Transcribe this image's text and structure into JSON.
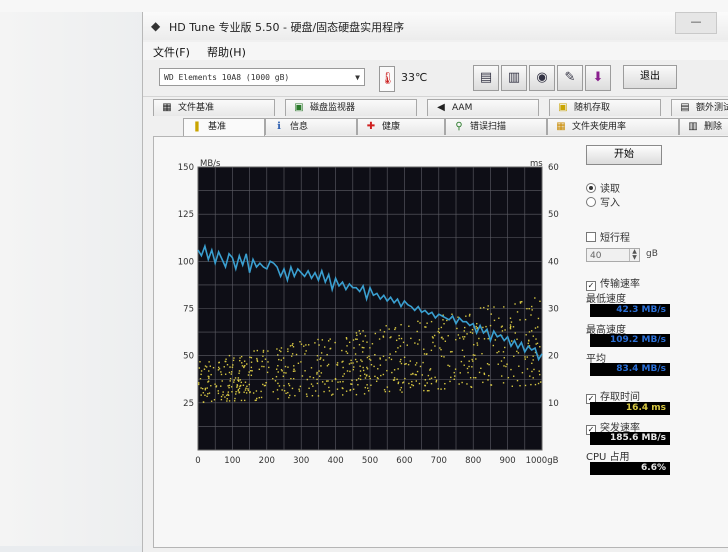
{
  "window": {
    "title": "HD Tune 专业版 5.50 - 硬盘/固态硬盘实用程序",
    "min_btn": "—",
    "menu": [
      "文件(F)",
      "帮助(H)"
    ]
  },
  "toolbar": {
    "drive": "WD    Elements 10A8 (1000 gB)",
    "temperature": "33℃",
    "exit_label": "退出"
  },
  "tabs_top": [
    "文件基准",
    "磁盘监视器",
    "AAM",
    "随机存取",
    "额外测试"
  ],
  "tabs_bottom": [
    "基准",
    "信息",
    "健康",
    "错误扫描",
    "文件夹使用率",
    "删除"
  ],
  "side": {
    "start_label": "开始",
    "read_label": "读取",
    "write_label": "写入",
    "short_stroke_label": "短行程",
    "short_stroke_value": "40",
    "gb_unit": "gB",
    "transfer_rate_label": "传输速率",
    "min_label": "最低速度",
    "min_value": "42.3 MB/s",
    "max_label": "最高速度",
    "max_value": "109.2 MB/s",
    "avg_label": "平均",
    "avg_value": "83.4 MB/s",
    "access_time_label": "存取时间",
    "access_time_value": "16.4 ms",
    "burst_label": "突发速率",
    "burst_value": "185.6 MB/s",
    "cpu_label": "CPU 占用",
    "cpu_value": "6.6%"
  },
  "chart_data": {
    "type": "line",
    "y_left_label": "MB/s",
    "y_right_label": "ms",
    "x_unit": "gB",
    "ylim_left": [
      0,
      150
    ],
    "ylim_right": [
      0,
      60
    ],
    "xlim": [
      0,
      1000
    ],
    "x_ticks": [
      "0",
      "100",
      "200",
      "300",
      "400",
      "500",
      "600",
      "700",
      "800",
      "900",
      "1000gB"
    ],
    "y_left_ticks": [
      "150",
      "125",
      "100",
      "75",
      "50",
      "25"
    ],
    "y_right_ticks": [
      "60",
      "50",
      "40",
      "30",
      "20",
      "10"
    ],
    "grid": true,
    "series": [
      {
        "name": "传输速率",
        "axis": "left",
        "color": "#3a9fd0",
        "x": [
          0,
          10,
          20,
          30,
          40,
          50,
          60,
          70,
          80,
          90,
          100,
          110,
          120,
          130,
          140,
          150,
          160,
          170,
          180,
          190,
          200,
          210,
          220,
          230,
          240,
          250,
          260,
          270,
          280,
          290,
          300,
          310,
          320,
          330,
          340,
          350,
          360,
          370,
          380,
          390,
          400,
          410,
          420,
          430,
          440,
          450,
          460,
          470,
          480,
          490,
          500,
          510,
          520,
          530,
          540,
          550,
          560,
          570,
          580,
          590,
          600,
          610,
          620,
          630,
          640,
          650,
          660,
          670,
          680,
          690,
          700,
          710,
          720,
          730,
          740,
          750,
          760,
          770,
          780,
          790,
          800,
          810,
          820,
          830,
          840,
          850,
          860,
          870,
          880,
          890,
          900,
          910,
          920,
          930,
          940,
          950,
          960,
          970,
          980,
          990,
          1000
        ],
        "y": [
          106,
          103,
          108,
          101,
          106,
          99,
          105,
          101,
          97,
          104,
          102,
          96,
          103,
          98,
          104,
          94,
          101,
          97,
          99,
          97,
          96,
          100,
          99,
          97,
          92,
          96,
          90,
          97,
          92,
          96,
          94,
          92,
          95,
          91,
          94,
          90,
          95,
          89,
          93,
          85,
          91,
          87,
          89,
          85,
          88,
          86,
          86,
          84,
          87,
          80,
          86,
          82,
          83,
          80,
          82,
          79,
          81,
          78,
          80,
          76,
          79,
          77,
          76,
          74,
          76,
          73,
          74,
          72,
          73,
          70,
          72,
          71,
          70,
          69,
          71,
          67,
          70,
          68,
          68,
          66,
          67,
          62,
          66,
          62,
          64,
          58,
          63,
          60,
          61,
          58,
          60,
          55,
          58,
          54,
          57,
          52,
          55,
          53,
          54,
          48,
          51
        ]
      }
    ],
    "access_time_scatter": {
      "name": "存取时间",
      "axis": "right",
      "color": "#d8c843",
      "x_range": [
        0,
        1000
      ],
      "ms_min_start": 10,
      "ms_max_start": 19,
      "ms_min_end": 14,
      "ms_max_end": 33
    }
  }
}
